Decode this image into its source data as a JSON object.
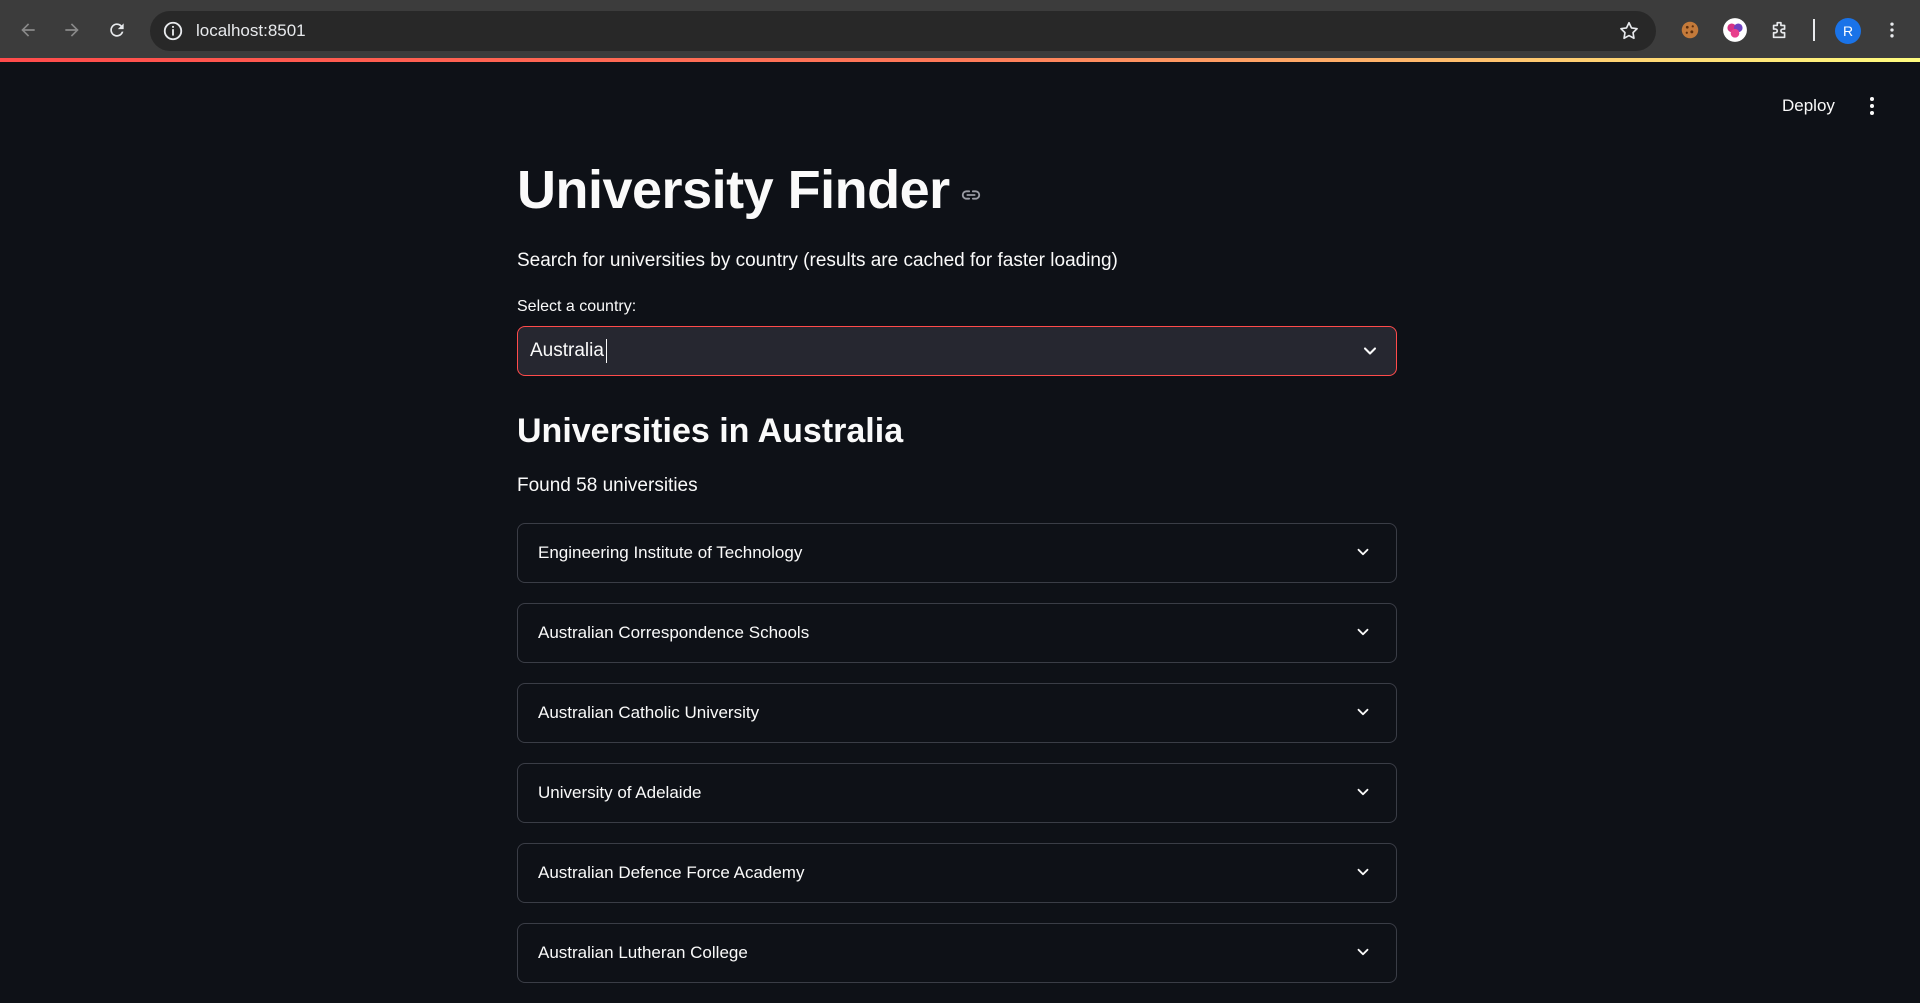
{
  "browser": {
    "url": "localhost:8501",
    "profile_initial": "R"
  },
  "app": {
    "deploy_label": "Deploy",
    "title": "University Finder",
    "subtitle": "Search for universities by country (results are cached for faster loading)",
    "select_label": "Select a country:",
    "selected_country": "Australia",
    "results_heading": "Universities in Australia",
    "found_text": "Found 58 universities",
    "universities": [
      {
        "name": "Engineering Institute of Technology"
      },
      {
        "name": "Australian Correspondence Schools"
      },
      {
        "name": "Australian Catholic University"
      },
      {
        "name": "University of Adelaide"
      },
      {
        "name": "Australian Defence Force Academy"
      },
      {
        "name": "Australian Lutheran College"
      }
    ]
  },
  "colors": {
    "background": "#0e1117",
    "accent": "#ff4b4b",
    "text": "#fafafa"
  }
}
